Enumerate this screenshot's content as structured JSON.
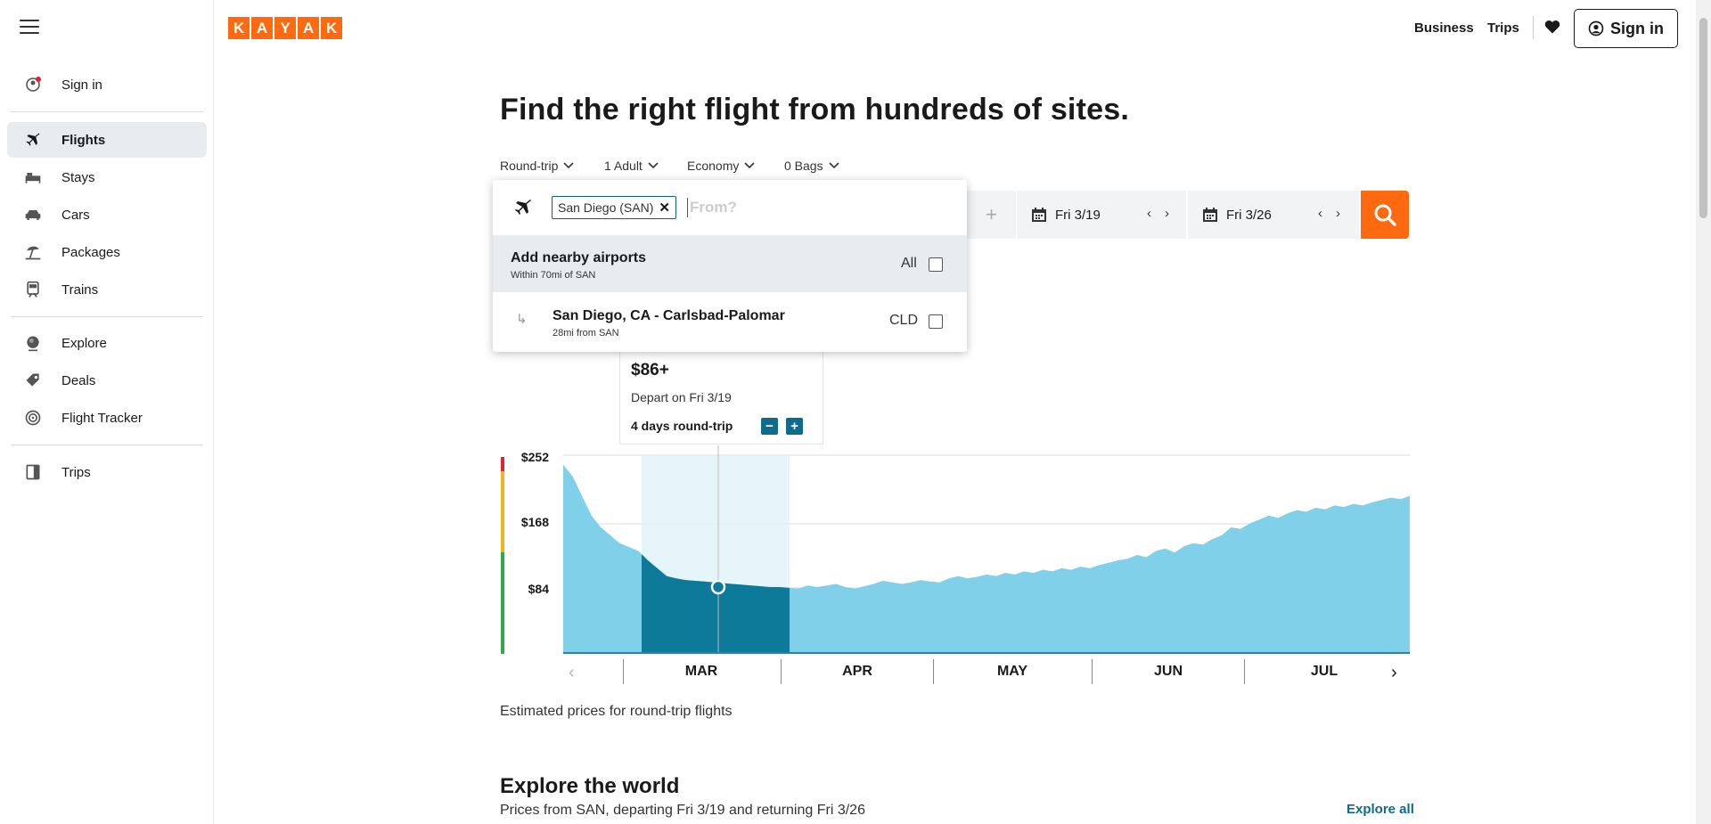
{
  "logo": [
    "K",
    "A",
    "Y",
    "A",
    "K"
  ],
  "sidebar": {
    "signin": "Sign in",
    "items": [
      {
        "label": "Flights",
        "icon": "plane-icon",
        "active": true
      },
      {
        "label": "Stays",
        "icon": "bed-icon"
      },
      {
        "label": "Cars",
        "icon": "car-icon"
      },
      {
        "label": "Packages",
        "icon": "umbrella-icon"
      },
      {
        "label": "Trains",
        "icon": "train-icon"
      }
    ],
    "items2": [
      {
        "label": "Explore",
        "icon": "globe-icon"
      },
      {
        "label": "Deals",
        "icon": "tag-icon"
      },
      {
        "label": "Flight Tracker",
        "icon": "radar-icon"
      }
    ],
    "items3": [
      {
        "label": "Trips",
        "icon": "suitcase-icon"
      }
    ]
  },
  "header": {
    "business": "Business",
    "trips": "Trips",
    "signin": "Sign in"
  },
  "headline": "Find the right flight from hundreds of sites.",
  "options": {
    "trip_type": "Round-trip",
    "travelers": "1 Adult",
    "cabin": "Economy",
    "bags": "0 Bags"
  },
  "search": {
    "origin_chip": "San Diego (SAN)",
    "from_placeholder": "From?",
    "depart_date": "Fri 3/19",
    "return_date": "Fri 3/26"
  },
  "dropdown": {
    "nearby_title": "Add nearby airports",
    "nearby_sub": "Within 70mi of SAN",
    "nearby_all": "All",
    "airport_name": "San Diego, CA - Carlsbad-Palomar",
    "airport_sub": "28mi from SAN",
    "airport_code": "CLD"
  },
  "tooltip": {
    "price": "$86+",
    "depart": "Depart on Fri 3/19",
    "duration": "4 days round-trip"
  },
  "colors": {
    "brand": "#ff690f",
    "chart_fill": "#7fd0e8",
    "chart_highlight": "#0e7a99",
    "accent": "#0e6b8c"
  },
  "chart_data": {
    "type": "area",
    "y_ticks": [
      "$252",
      "$168",
      "$84"
    ],
    "ylim": [
      0,
      252
    ],
    "months": [
      "MAR",
      "APR",
      "MAY",
      "JUN",
      "JUL"
    ],
    "selected_range": "MAR",
    "values": [
      240,
      225,
      200,
      175,
      160,
      150,
      140,
      135,
      130,
      118,
      108,
      98,
      95,
      93,
      92,
      91,
      90,
      89,
      88,
      87,
      86,
      85,
      84,
      84,
      83,
      82,
      86,
      84,
      86,
      88,
      84,
      82,
      85,
      88,
      92,
      90,
      88,
      90,
      93,
      91,
      90,
      95,
      98,
      95,
      97,
      100,
      98,
      102,
      100,
      104,
      102,
      106,
      104,
      108,
      106,
      110,
      108,
      112,
      115,
      118,
      120,
      125,
      122,
      130,
      133,
      128,
      136,
      140,
      138,
      145,
      150,
      160,
      158,
      165,
      170,
      175,
      172,
      178,
      182,
      180,
      185,
      183,
      188,
      186,
      190,
      188,
      192,
      195,
      198,
      196,
      200
    ],
    "caption": "Estimated prices for round-trip flights"
  },
  "explore": {
    "title": "Explore the world",
    "subtitle": "Prices from SAN, departing Fri 3/19 and returning Fri 3/26",
    "link": "Explore all"
  }
}
